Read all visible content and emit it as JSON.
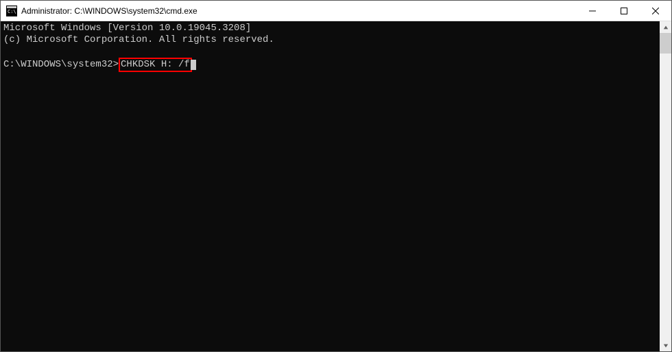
{
  "titlebar": {
    "text": "Administrator: C:\\WINDOWS\\system32\\cmd.exe"
  },
  "terminal": {
    "line1": "Microsoft Windows [Version 10.0.19045.3208]",
    "line2": "(c) Microsoft Corporation. All rights reserved.",
    "prompt": "C:\\WINDOWS\\system32>",
    "command": "CHKDSK H: /f"
  }
}
